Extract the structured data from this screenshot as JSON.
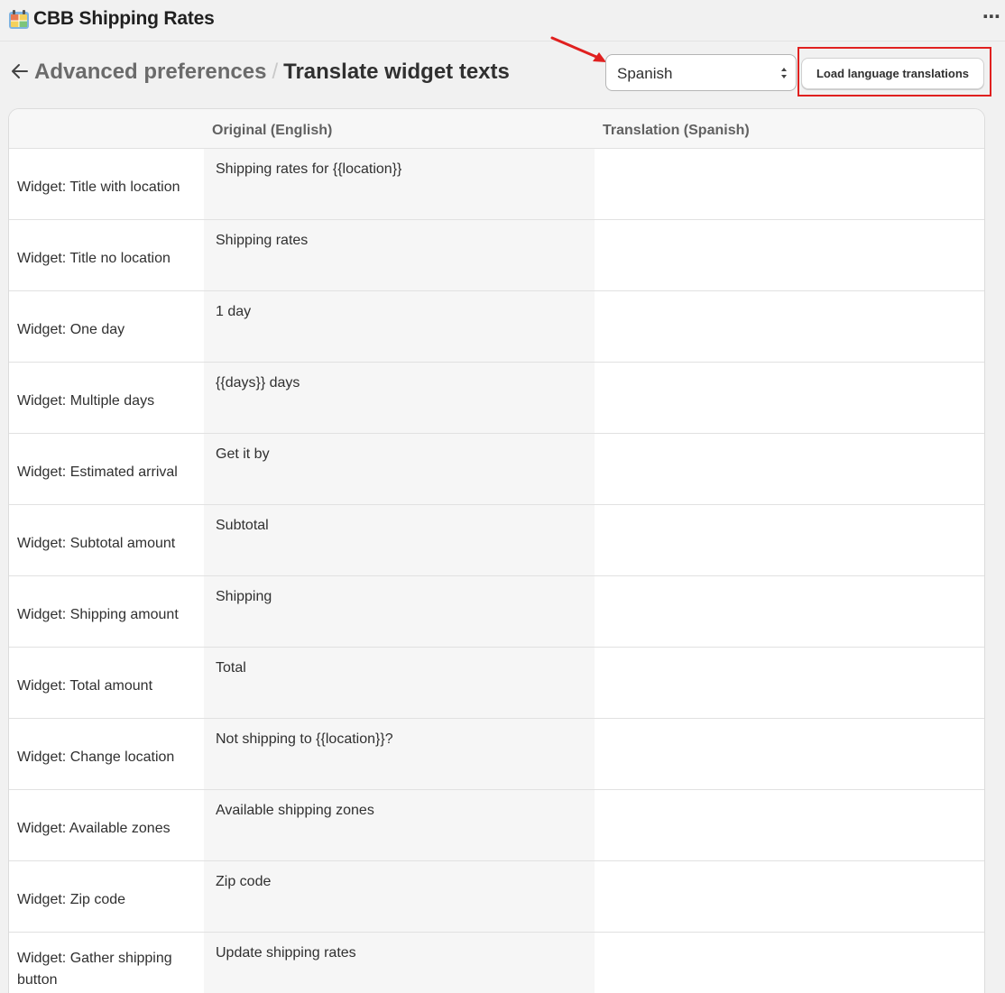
{
  "app": {
    "title": "CBB Shipping Rates",
    "more_icon": "more-horizontal-icon"
  },
  "header": {
    "back_icon": "arrow-left-icon",
    "breadcrumb_parent": "Advanced preferences",
    "breadcrumb_separator": "/",
    "page_title": "Translate widget texts",
    "language_select": {
      "selected": "Spanish"
    },
    "load_button_label": "Load language translations"
  },
  "annotation": {
    "color": "#e0201f"
  },
  "table": {
    "headers": {
      "label": "",
      "original": "Original (English)",
      "translation": "Translation (Spanish)"
    },
    "rows": [
      {
        "label": "Widget: Title with location",
        "original": "Shipping rates for {{location}}",
        "translation": ""
      },
      {
        "label": "Widget: Title no location",
        "original": "Shipping rates",
        "translation": ""
      },
      {
        "label": "Widget: One day",
        "original": "1 day",
        "translation": ""
      },
      {
        "label": "Widget: Multiple days",
        "original": "{{days}} days",
        "translation": ""
      },
      {
        "label": "Widget: Estimated arrival",
        "original": "Get it by",
        "translation": ""
      },
      {
        "label": "Widget: Subtotal amount",
        "original": "Subtotal",
        "translation": ""
      },
      {
        "label": "Widget: Shipping amount",
        "original": "Shipping",
        "translation": ""
      },
      {
        "label": "Widget: Total amount",
        "original": "Total",
        "translation": ""
      },
      {
        "label": "Widget: Change location",
        "original": "Not shipping to {{location}}?",
        "translation": ""
      },
      {
        "label": "Widget: Available zones",
        "original": "Available shipping zones",
        "translation": ""
      },
      {
        "label": "Widget: Zip code",
        "original": "Zip code",
        "translation": ""
      },
      {
        "label": "Widget: Gather shipping button",
        "original": "Update shipping rates",
        "translation": ""
      }
    ]
  }
}
